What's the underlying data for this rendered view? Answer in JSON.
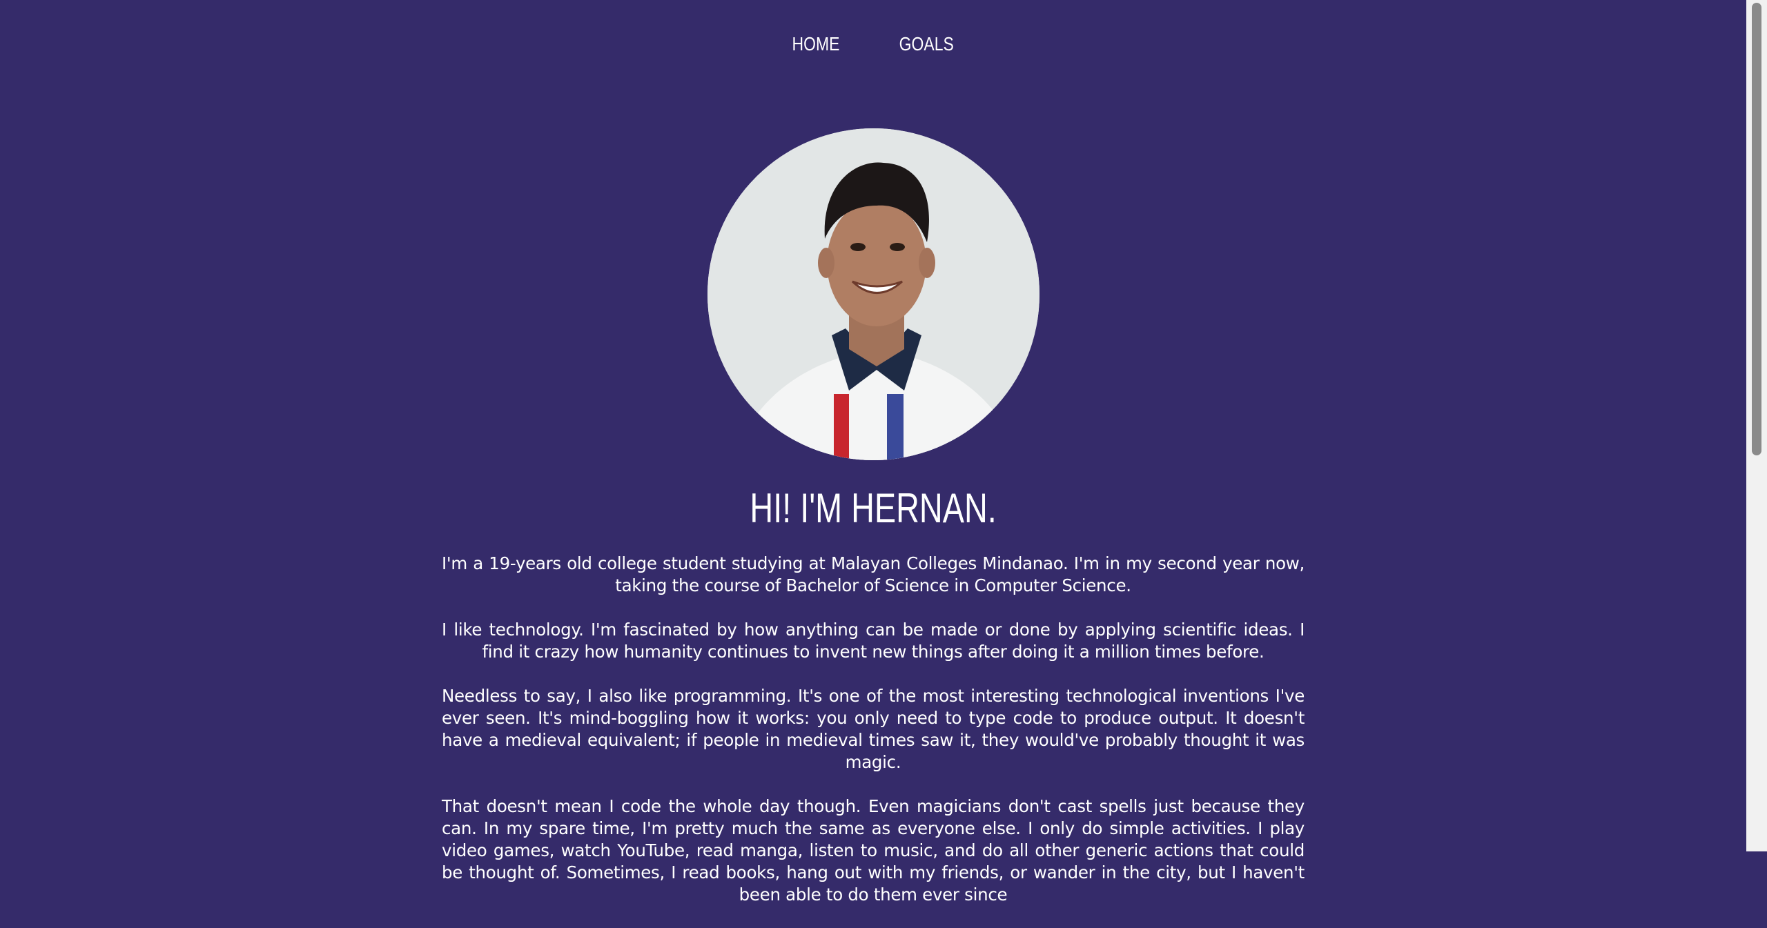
{
  "nav": {
    "items": [
      {
        "label": "HOME"
      },
      {
        "label": "GOALS"
      }
    ]
  },
  "profile": {
    "heading": "HI! I'M HERNAN."
  },
  "bio": {
    "paragraphs": [
      "I'm a 19-years old college student studying at Malayan Colleges Mindanao. I'm in my second year now, taking the course of Bachelor of Science in Computer Science.",
      "I like technology. I'm fascinated by how anything can be made or done by applying scientific ideas. I find it crazy how humanity continues to invent new things after doing it a million times before.",
      "Needless to say, I also like programming. It's one of the most interesting technological inventions I've ever seen. It's mind-boggling how it works: you only need to type code to produce output. It doesn't have a medieval equivalent; if people in medieval times saw it, they would've probably thought it was magic.",
      "That doesn't mean I code the whole day though. Even magicians don't cast spells just because they can. In my spare time, I'm pretty much the same as everyone else. I only do simple activities. I play video games, watch YouTube, read manga, listen to music, and do all other generic actions that could be thought of. Sometimes, I read books, hang out with my friends, or wander in the city, but I haven't been able to do them ever since"
    ]
  },
  "colors": {
    "background": "#352b6a",
    "text": "#ffffff"
  }
}
